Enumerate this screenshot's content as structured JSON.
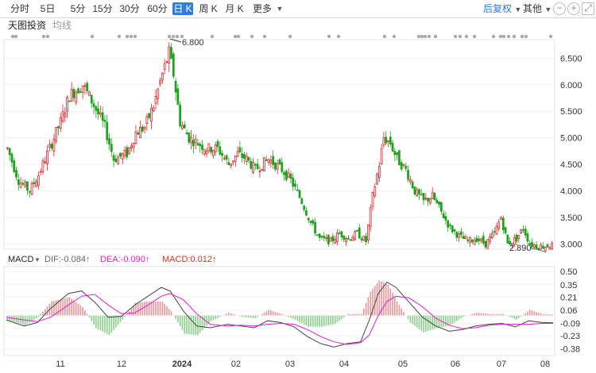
{
  "toolbar": {
    "tabs": [
      {
        "label": "分时",
        "active": false
      },
      {
        "label": "5日",
        "active": false
      },
      {
        "label": "5分",
        "active": false
      },
      {
        "label": "15分",
        "active": false
      },
      {
        "label": "30分",
        "active": false
      },
      {
        "label": "60分",
        "active": false
      },
      {
        "label": "日 K",
        "active": true
      },
      {
        "label": "周 K",
        "active": false
      },
      {
        "label": "月 K",
        "active": false
      },
      {
        "label": "更多",
        "active": false
      }
    ],
    "adjust_label": "后复权",
    "other_label": "其他",
    "icons": [
      "minus-circle-icon",
      "plus-circle-icon",
      "fullscreen-icon"
    ]
  },
  "chart_header": {
    "brand": "天图投资",
    "indicator": "均线"
  },
  "price_axis": {
    "ticks": [
      "6.500",
      "6.000",
      "5.500",
      "5.000",
      "4.500",
      "4.000",
      "3.500",
      "3.000"
    ]
  },
  "annotations": {
    "high": "6.800",
    "low": "2.890"
  },
  "macd": {
    "name": "MACD",
    "dif": "DIF:-0.084↑",
    "dea": "DEA:-0.090↑",
    "macd": "MACD:0.012↑",
    "colors": {
      "dif": "#666666",
      "dea": "#e81dd3",
      "macd": "#d93025"
    },
    "ticks": [
      "0.50",
      "0.35",
      "0.21",
      "0.06",
      "-0.09",
      "-0.23",
      "-0.38"
    ]
  },
  "time_axis": {
    "labels": [
      "11",
      "12",
      "2024",
      "02",
      "03",
      "04",
      "05",
      "06",
      "07",
      "08"
    ]
  },
  "colors": {
    "up": "#e0262a",
    "down": "#1ea21e",
    "accent": "#2e7de1"
  },
  "chart_data": {
    "type": "candlestick",
    "ylim": [
      2.9,
      6.85
    ],
    "high": 6.8,
    "low": 2.89,
    "close_path": [
      [
        0,
        4.8
      ],
      [
        5,
        4.2
      ],
      [
        10,
        4.0
      ],
      [
        14,
        4.3
      ],
      [
        18,
        4.7
      ],
      [
        24,
        5.3
      ],
      [
        28,
        5.8
      ],
      [
        34,
        6.0
      ],
      [
        38,
        5.7
      ],
      [
        44,
        5.2
      ],
      [
        48,
        4.6
      ],
      [
        54,
        4.7
      ],
      [
        58,
        5.1
      ],
      [
        62,
        5.2
      ],
      [
        66,
        5.6
      ],
      [
        70,
        6.2
      ],
      [
        73,
        6.6
      ],
      [
        75,
        6.2
      ],
      [
        78,
        5.3
      ],
      [
        82,
        5.0
      ],
      [
        86,
        4.9
      ],
      [
        90,
        4.8
      ],
      [
        95,
        4.8
      ],
      [
        100,
        4.5
      ],
      [
        104,
        4.7
      ],
      [
        108,
        4.6
      ],
      [
        112,
        4.4
      ],
      [
        118,
        4.6
      ],
      [
        124,
        4.4
      ],
      [
        128,
        4.2
      ],
      [
        133,
        3.8
      ],
      [
        137,
        3.4
      ],
      [
        141,
        3.1
      ],
      [
        146,
        3.05
      ],
      [
        150,
        3.2
      ],
      [
        154,
        3.1
      ],
      [
        158,
        3.2
      ],
      [
        162,
        3.05
      ],
      [
        165,
        3.9
      ],
      [
        168,
        4.5
      ],
      [
        170,
        5.0
      ],
      [
        173,
        4.9
      ],
      [
        176,
        4.6
      ],
      [
        180,
        4.4
      ],
      [
        184,
        4.0
      ],
      [
        188,
        3.8
      ],
      [
        192,
        3.9
      ],
      [
        196,
        3.6
      ],
      [
        200,
        3.3
      ],
      [
        204,
        3.15
      ],
      [
        208,
        3.05
      ],
      [
        212,
        3.1
      ],
      [
        216,
        3.0
      ],
      [
        220,
        3.2
      ],
      [
        223,
        3.5
      ],
      [
        226,
        3.0
      ],
      [
        230,
        3.1
      ],
      [
        233,
        3.3
      ],
      [
        236,
        3.0
      ],
      [
        240,
        2.95
      ],
      [
        245,
        2.97
      ]
    ],
    "macd_dif_path": [
      [
        0,
        -0.05
      ],
      [
        8,
        -0.12
      ],
      [
        14,
        -0.08
      ],
      [
        20,
        0.08
      ],
      [
        28,
        0.25
      ],
      [
        34,
        0.28
      ],
      [
        40,
        0.15
      ],
      [
        46,
        -0.02
      ],
      [
        52,
        -0.01
      ],
      [
        58,
        0.12
      ],
      [
        64,
        0.22
      ],
      [
        70,
        0.32
      ],
      [
        74,
        0.28
      ],
      [
        80,
        0.05
      ],
      [
        86,
        -0.12
      ],
      [
        92,
        -0.14
      ],
      [
        100,
        -0.1
      ],
      [
        106,
        -0.12
      ],
      [
        112,
        -0.14
      ],
      [
        118,
        -0.06
      ],
      [
        124,
        -0.08
      ],
      [
        130,
        -0.13
      ],
      [
        136,
        -0.24
      ],
      [
        142,
        -0.32
      ],
      [
        148,
        -0.36
      ],
      [
        154,
        -0.32
      ],
      [
        160,
        -0.3
      ],
      [
        164,
        -0.05
      ],
      [
        168,
        0.25
      ],
      [
        172,
        0.38
      ],
      [
        176,
        0.32
      ],
      [
        182,
        0.15
      ],
      [
        188,
        -0.02
      ],
      [
        194,
        -0.12
      ],
      [
        200,
        -0.18
      ],
      [
        206,
        -0.16
      ],
      [
        212,
        -0.12
      ],
      [
        218,
        -0.1
      ],
      [
        224,
        -0.09
      ],
      [
        230,
        -0.13
      ],
      [
        236,
        -0.06
      ],
      [
        242,
        -0.08
      ],
      [
        247,
        -0.084
      ]
    ],
    "macd_dea_path": [
      [
        0,
        -0.02
      ],
      [
        8,
        -0.05
      ],
      [
        14,
        -0.07
      ],
      [
        20,
        -0.02
      ],
      [
        28,
        0.12
      ],
      [
        34,
        0.22
      ],
      [
        40,
        0.24
      ],
      [
        46,
        0.12
      ],
      [
        52,
        0.02
      ],
      [
        58,
        0.03
      ],
      [
        64,
        0.12
      ],
      [
        70,
        0.22
      ],
      [
        74,
        0.25
      ],
      [
        80,
        0.18
      ],
      [
        86,
        0.02
      ],
      [
        92,
        -0.1
      ],
      [
        100,
        -0.12
      ],
      [
        106,
        -0.11
      ],
      [
        112,
        -0.12
      ],
      [
        118,
        -0.1
      ],
      [
        124,
        -0.09
      ],
      [
        130,
        -0.1
      ],
      [
        136,
        -0.16
      ],
      [
        142,
        -0.24
      ],
      [
        148,
        -0.3
      ],
      [
        154,
        -0.33
      ],
      [
        160,
        -0.31
      ],
      [
        164,
        -0.22
      ],
      [
        168,
        0.0
      ],
      [
        172,
        0.16
      ],
      [
        176,
        0.22
      ],
      [
        182,
        0.2
      ],
      [
        188,
        0.1
      ],
      [
        194,
        -0.03
      ],
      [
        200,
        -0.11
      ],
      [
        206,
        -0.15
      ],
      [
        212,
        -0.14
      ],
      [
        218,
        -0.11
      ],
      [
        224,
        -0.1
      ],
      [
        230,
        -0.1
      ],
      [
        236,
        -0.1
      ],
      [
        242,
        -0.09
      ],
      [
        247,
        -0.09
      ]
    ]
  }
}
